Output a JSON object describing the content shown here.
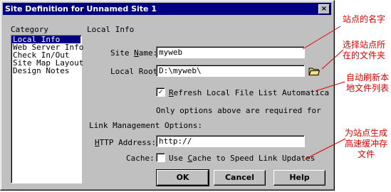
{
  "window": {
    "title": "Site Definition for Unnamed Site 1",
    "close_glyph": "×"
  },
  "category": {
    "heading": "Category",
    "items": [
      {
        "label": "Local Info",
        "selected": true
      },
      {
        "label": "Web Server Info",
        "selected": false
      },
      {
        "label": "Check In/Out",
        "selected": false
      },
      {
        "label": "Site Map Layout",
        "selected": false
      },
      {
        "label": "Design Notes",
        "selected": false
      }
    ]
  },
  "local_info": {
    "heading": "Local Info",
    "site_name_label_pre": "Site ",
    "site_name_label_key": "N",
    "site_name_label_post": "ame:",
    "site_name_value": "myweb",
    "local_root_label": "Local Root",
    "local_root_value": "D:\\myweb\\",
    "refresh_checked": true,
    "refresh_label_key": "R",
    "refresh_label_rest": "efresh Local File List Automatica",
    "note": "Only options above are required for"
  },
  "link_management": {
    "heading": "Link Management Options:",
    "http_label_key": "H",
    "http_label_rest": "TTP Address:",
    "http_value": "http://",
    "cache_label": "Cache:",
    "cache_checked": false,
    "cache_option_pre": "Use ",
    "cache_option_key": "C",
    "cache_option_post": "ache to Speed Link Updates"
  },
  "buttons": {
    "ok": "OK",
    "cancel": "Cancel",
    "help": "Help"
  },
  "annotations": {
    "site_name": "站点的名字",
    "folder_line1": "选择站点所",
    "folder_line2": "在的文件夹",
    "refresh_line1": "自动刷新本",
    "refresh_line2": "地文件列表",
    "cache_line1": "为站点生成",
    "cache_line2": "高速缓冲存",
    "cache_line3": "文件"
  },
  "colors": {
    "annotation": "#e00000",
    "titlebar": "#000080",
    "dialog": "#c0c0c0"
  },
  "icons": {
    "folder": "folder-icon",
    "close": "close-icon"
  }
}
